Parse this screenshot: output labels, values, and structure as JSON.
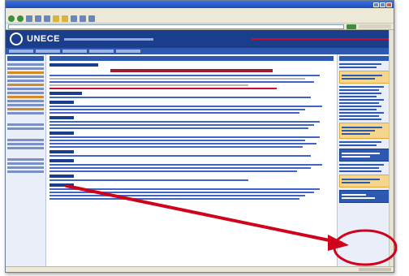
{
  "window": {
    "title": ""
  },
  "menu": [
    "",
    "",
    "",
    "",
    "",
    ""
  ],
  "banner": {
    "logo": "",
    "brand": "UNECE"
  },
  "news": {
    "heading": ""
  },
  "statusbar": {
    "text": ""
  },
  "annotation": {
    "color": "#d0021b"
  }
}
